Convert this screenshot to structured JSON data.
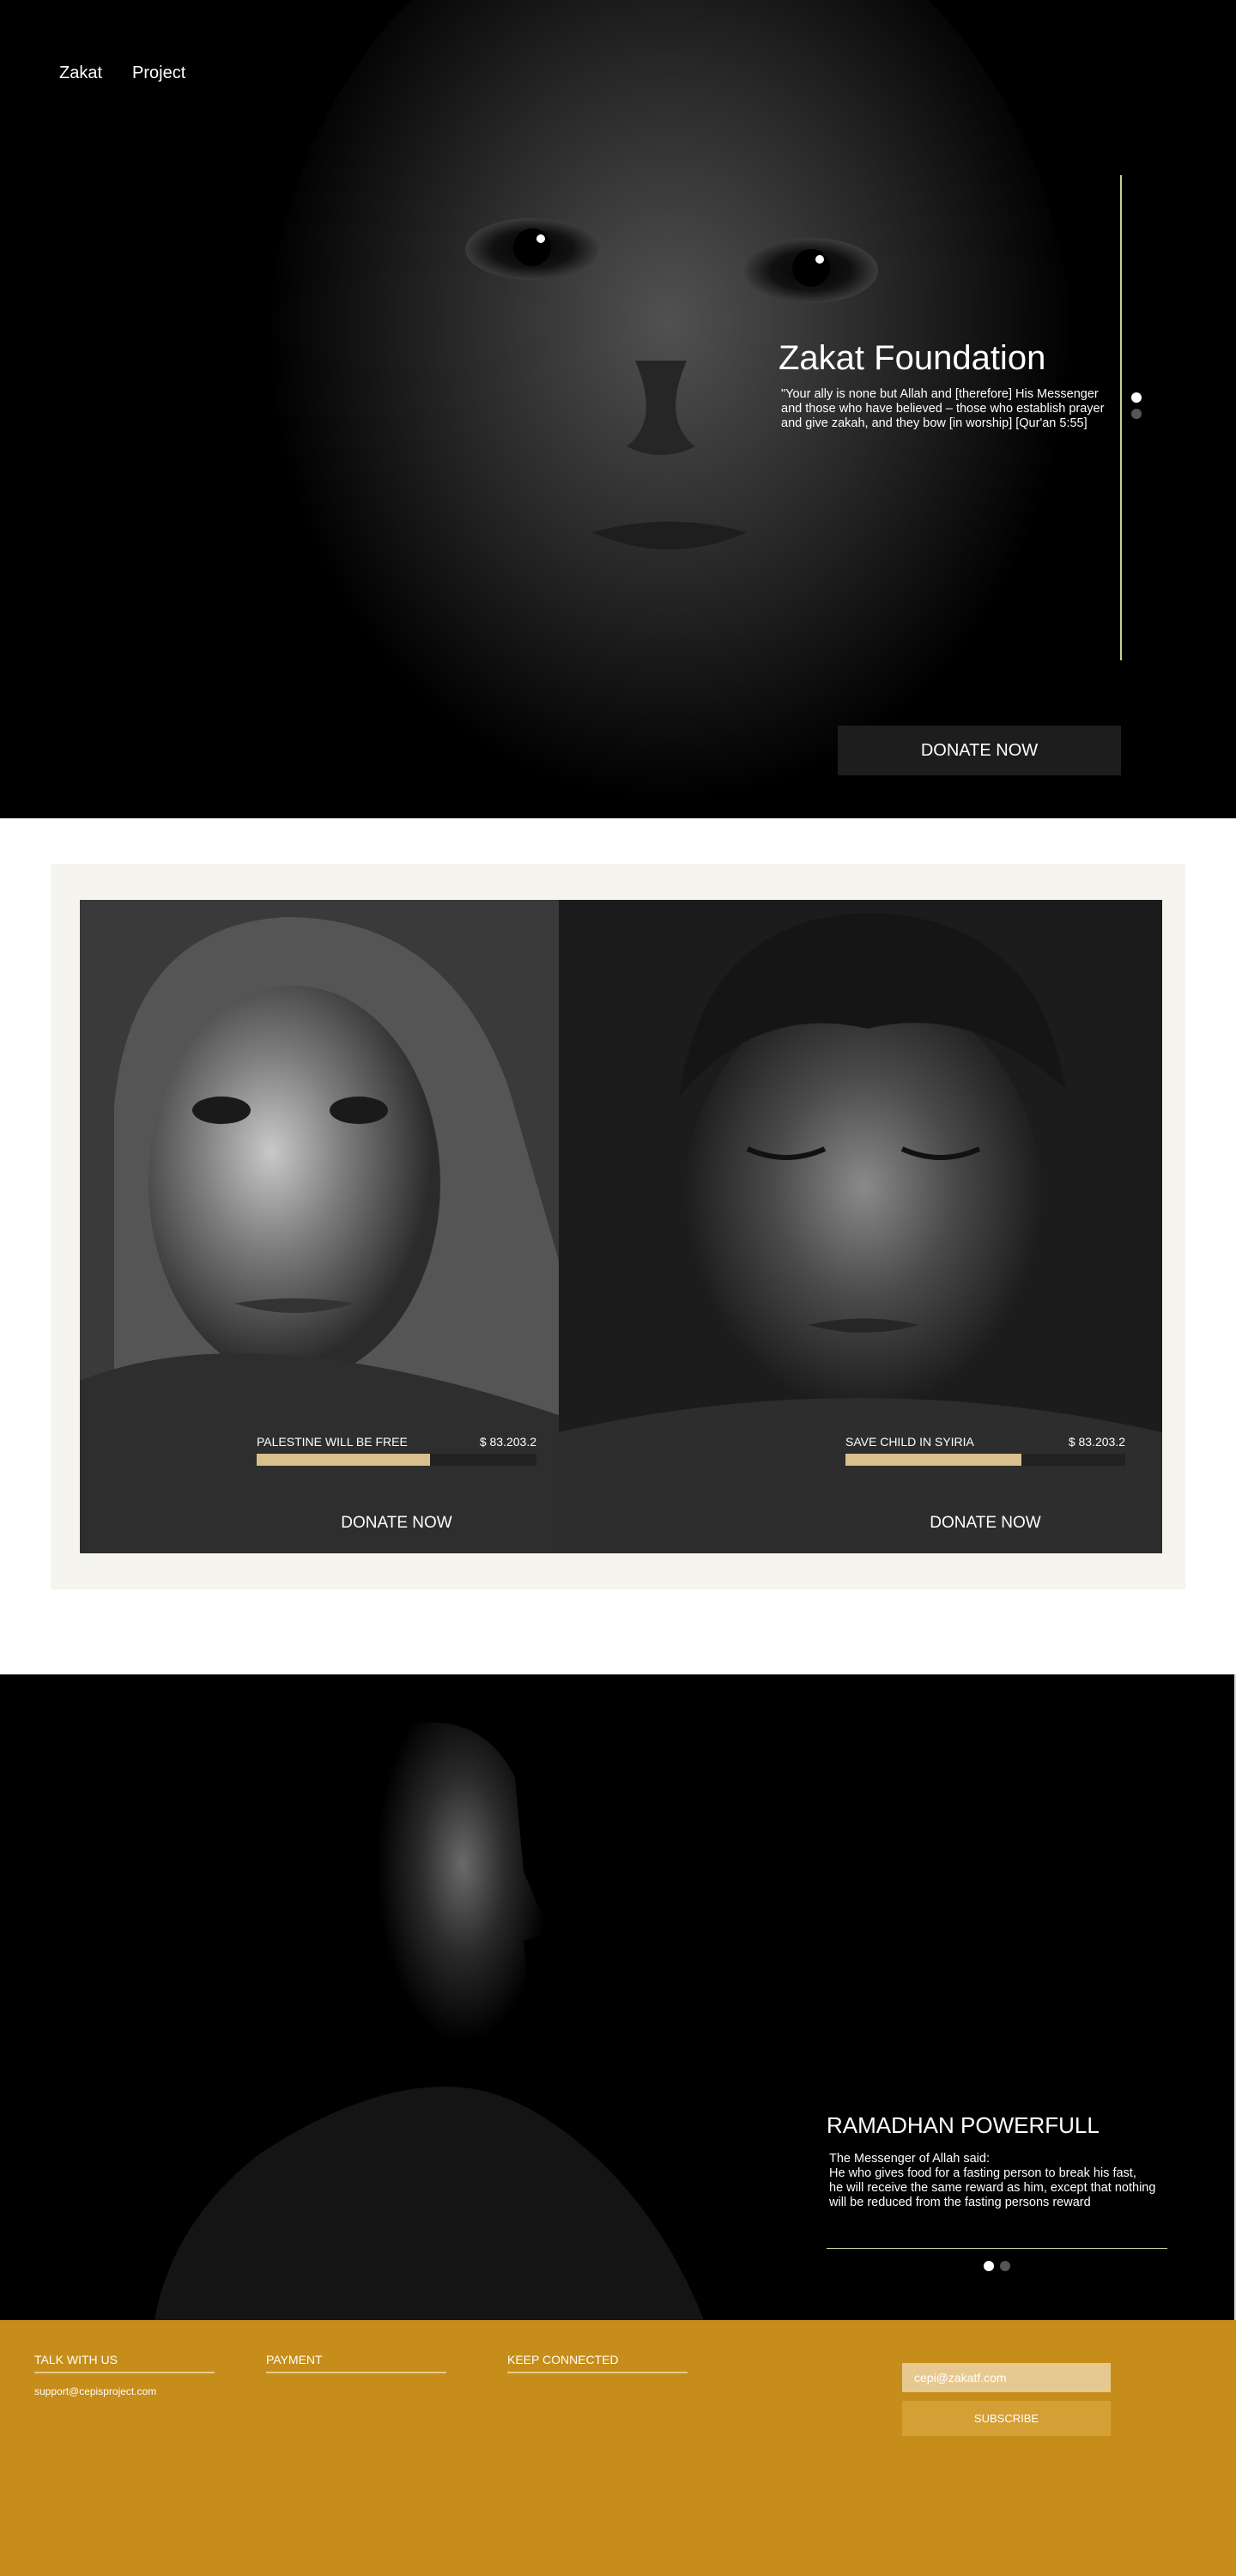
{
  "nav": {
    "items": [
      {
        "label": "Zakat"
      },
      {
        "label": "Project"
      }
    ]
  },
  "hero": {
    "title": "Zakat Foundation",
    "quote": "\"Your ally is none but Allah and [therefore] His Messenger\nand those who have believed – those who establish prayer\n and give zakah, and they bow [in worship] [Qur'an 5:55]",
    "donate_label": "DONATE NOW",
    "slider": {
      "total": 2,
      "active": 1
    }
  },
  "campaigns": [
    {
      "name": "PALESTINE WILL BE FREE",
      "amount": "$ 83.203.2",
      "progress": 0.62,
      "donate_label": "DONATE NOW"
    },
    {
      "name": "SAVE CHILD IN SYIRIA",
      "amount": "$ 83.203.2",
      "progress": 0.63,
      "donate_label": "DONATE NOW"
    }
  ],
  "ramadhan": {
    "title": "RAMADHAN POWERFULL",
    "text": "The Messenger of Allah said:\nHe who gives food for a fasting person to break his fast,\nhe will receive the same reward as him, except that nothing\nwill be reduced from the fasting persons reward",
    "slider": {
      "total": 2,
      "active": 1
    }
  },
  "footer": {
    "talk": {
      "title": "TALK WITH US",
      "email": "support@cepisproject.com"
    },
    "payment": {
      "title": "PAYMENT"
    },
    "connected": {
      "title": "KEEP CONNECTED"
    },
    "subscribe": {
      "placeholder": "cepi@zakatf.com",
      "button_label": "SUBSCRIBE"
    }
  },
  "colors": {
    "accent": "#c68d1a",
    "progress": "#d9c08c",
    "line": "#cfcf9a"
  }
}
